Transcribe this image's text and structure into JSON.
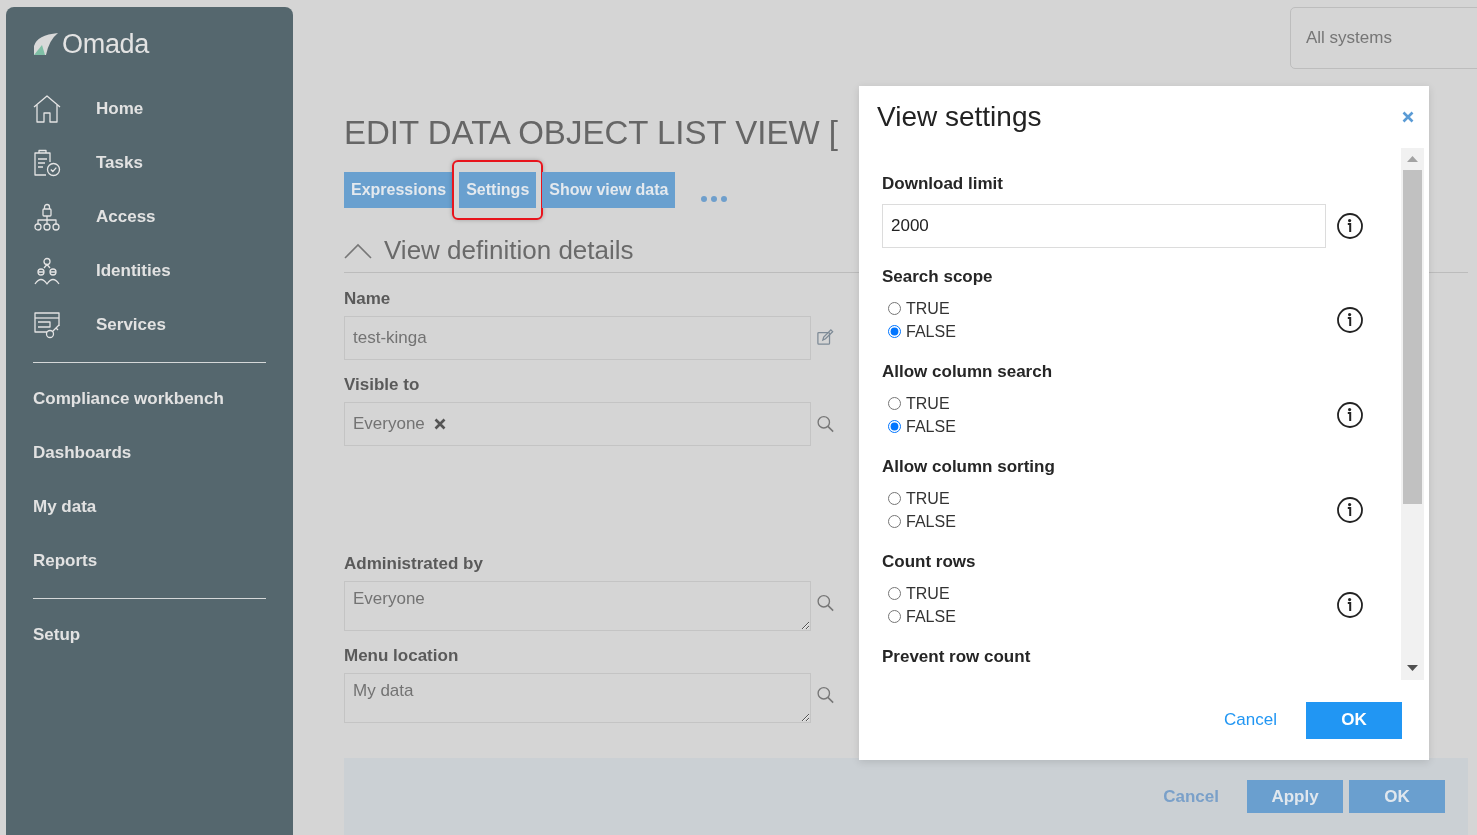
{
  "sidebar": {
    "logo": "Omada",
    "nav": [
      {
        "label": "Home",
        "kind": "home"
      },
      {
        "label": "Tasks",
        "kind": "tasks"
      },
      {
        "label": "Access",
        "kind": "access"
      },
      {
        "label": "Identities",
        "kind": "identities"
      },
      {
        "label": "Services",
        "kind": "services"
      }
    ],
    "link_groups": [
      {
        "items": [
          "Compliance workbench",
          "Dashboards",
          "My data",
          "Reports"
        ]
      },
      {
        "items": [
          "Setup"
        ]
      }
    ]
  },
  "top_bar": {
    "system_selector": "All systems"
  },
  "page": {
    "title": "EDIT DATA OBJECT LIST VIEW [",
    "actions": [
      {
        "label": "Expressions",
        "highlighted": false
      },
      {
        "label": "Settings",
        "highlighted": true
      },
      {
        "label": "Show view data",
        "highlighted": false
      }
    ],
    "section": {
      "title": "View definition details",
      "expanded": true
    },
    "fields": [
      {
        "label": "Name",
        "kind": "text",
        "value": "test-kinga"
      },
      {
        "label": "Visible to",
        "kind": "chips",
        "chips": [
          "Everyone"
        ]
      },
      {
        "label": "Administrated by",
        "kind": "textarea",
        "value": "Everyone"
      },
      {
        "label": "Menu location",
        "kind": "textarea",
        "value": "My data"
      }
    ]
  },
  "footer": {
    "cancel": "Cancel",
    "buttons": [
      "Apply",
      "OK"
    ]
  },
  "dialog": {
    "title": "View settings",
    "settings": [
      {
        "label": "Download limit",
        "kind": "number",
        "value": "2000",
        "info": true
      },
      {
        "label": "Search scope",
        "kind": "boolean",
        "info": true,
        "options": [
          {
            "label": "TRUE",
            "selected": false
          },
          {
            "label": "FALSE",
            "selected": true
          }
        ]
      },
      {
        "label": "Allow column search",
        "kind": "boolean",
        "info": true,
        "options": [
          {
            "label": "TRUE",
            "selected": false
          },
          {
            "label": "FALSE",
            "selected": true
          }
        ]
      },
      {
        "label": "Allow column sorting",
        "kind": "boolean",
        "info": true,
        "options": [
          {
            "label": "TRUE",
            "selected": false
          },
          {
            "label": "FALSE",
            "selected": false
          }
        ]
      },
      {
        "label": "Count rows",
        "kind": "boolean",
        "info": true,
        "options": [
          {
            "label": "TRUE",
            "selected": false
          },
          {
            "label": "FALSE",
            "selected": false
          }
        ]
      },
      {
        "label": "Prevent row count",
        "kind": "boolean"
      }
    ],
    "buttons": [
      {
        "label": "Cancel",
        "kind": "link"
      },
      {
        "label": "OK",
        "kind": "primary"
      }
    ]
  }
}
